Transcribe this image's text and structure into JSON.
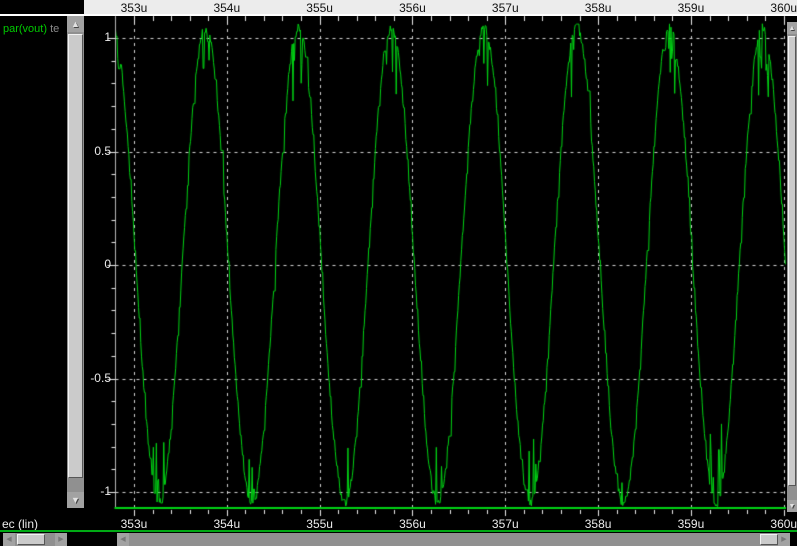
{
  "signal_panel": {
    "signals": [
      {
        "name": "par(vout)",
        "suffix": " te"
      }
    ]
  },
  "icons": {
    "scroll_up": "▲",
    "scroll_down": "▼",
    "scroll_left": "◀",
    "scroll_right": "▶"
  },
  "colors": {
    "waveform_green": "#00d414",
    "grid_dash": "#d6d6d6",
    "tick_white": "#ececec",
    "axis_line_gray": "#b8b8b8",
    "axis_strip_bg": "#ececec",
    "axis_text_dark": "#101010",
    "axis_text_light": "#ececec",
    "signal_green": "#00cc00",
    "signal_suffix_gray": "#8a8a8a",
    "separator_green": "#00aa14",
    "plot_bg": "#000000"
  },
  "chart_data": {
    "type": "line",
    "title": "",
    "x_axis": {
      "label": "ec (lin)",
      "scale": "lin",
      "tick_values_us": [
        353,
        354,
        355,
        356,
        357,
        358,
        359,
        360
      ],
      "tick_labels": [
        "353u",
        "354u",
        "355u",
        "356u",
        "357u",
        "358u",
        "359u",
        "360u"
      ],
      "minor_step_us": 0.2
    },
    "y_axis": {
      "tick_values": [
        1,
        0.5,
        0,
        -0.5,
        -1
      ],
      "tick_labels": [
        "1",
        "0.5",
        "0",
        "-0.5",
        "-1"
      ],
      "minor_step": 0.1,
      "minor_range": [
        -1.0,
        1.0
      ]
    },
    "xlim_us": [
      352.801,
      360.024
    ],
    "ylim": [
      -1.07,
      1.097
    ],
    "grid": "dashed",
    "legend_position": "left-panel",
    "series": [
      {
        "name": "par(vout)",
        "color": "#00d414",
        "shape": "noisy_sine",
        "amplitude": 1.045,
        "period_us": 1.0,
        "peak_time_us": 352.77,
        "noise": 0.02,
        "glitch_depth": 0.2,
        "glitch_prob": 0.3,
        "hold_prob": 0.15,
        "seed": 20
      }
    ]
  }
}
